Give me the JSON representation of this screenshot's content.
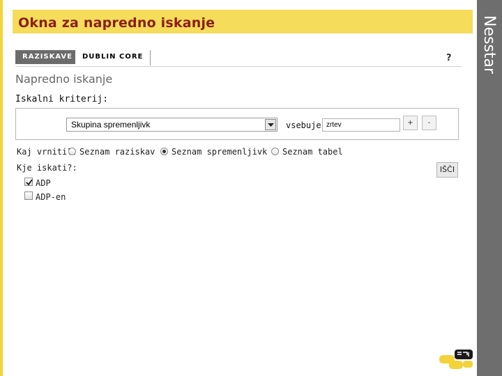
{
  "slide": {
    "title": "Okna za napredno iskanje",
    "side_label": "Nesstar"
  },
  "tabs": [
    {
      "label": "RAZISKAVE",
      "active": true
    },
    {
      "label": "DUBLIN CORE",
      "active": false
    }
  ],
  "help": "?",
  "page": {
    "heading": "Napredno iskanje",
    "criteria_label": "Iskalni kriterij:"
  },
  "criteria": {
    "field_selected": "Skupina spremenljivk",
    "operator": "vsebuje",
    "value": "zrtev",
    "add_label": "+",
    "remove_label": "-"
  },
  "return_type": {
    "label": "Kaj vrniti?:",
    "options": [
      {
        "label": "Seznam raziskav",
        "selected": false
      },
      {
        "label": "Seznam spremenljivk",
        "selected": true
      },
      {
        "label": "Seznam tabel",
        "selected": false
      }
    ]
  },
  "search_scope": {
    "label": "Kje iskati?:",
    "options": [
      {
        "label": "ADP",
        "checked": true
      },
      {
        "label": "ADP-en",
        "checked": false
      }
    ]
  },
  "search_button": "IŠČI",
  "colors": {
    "title_bar": "#f5dc5a",
    "title_text": "#8a1f11",
    "side_band": "#6e6e6e",
    "tab_active": "#6b6b6b"
  }
}
